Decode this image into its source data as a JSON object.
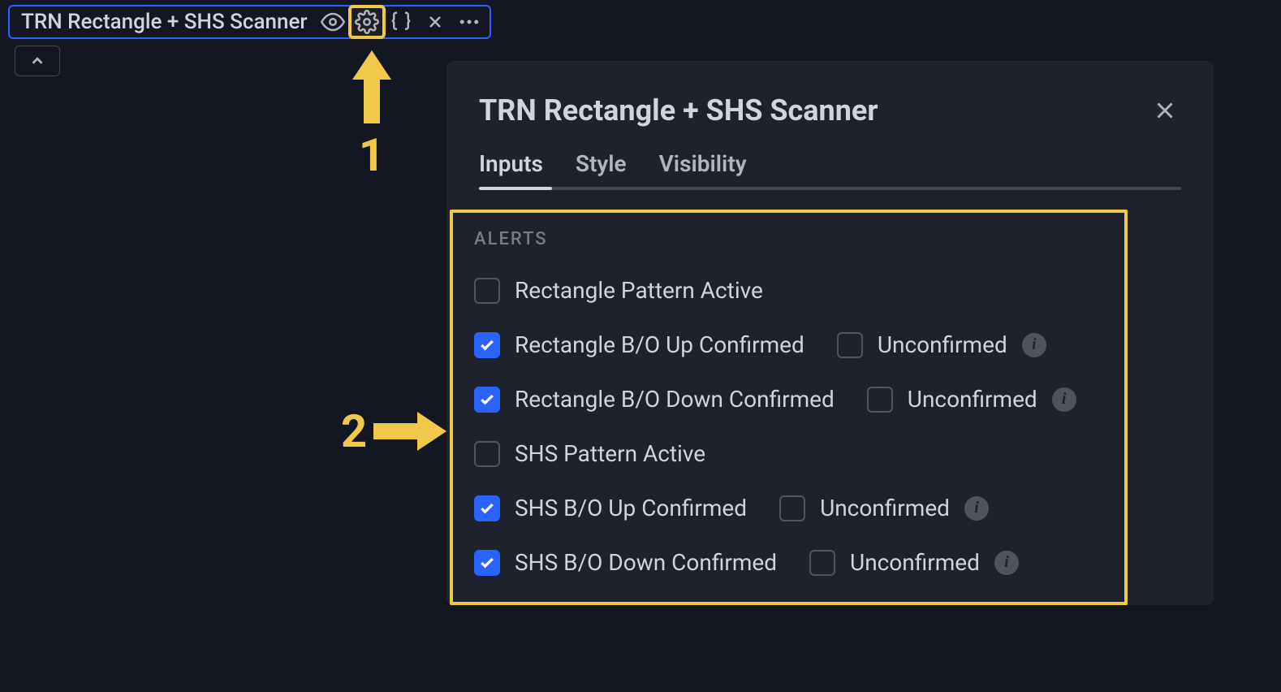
{
  "toolbar": {
    "title": "TRN Rectangle + SHS Scanner"
  },
  "annotations": {
    "one": "1",
    "two": "2"
  },
  "dialog": {
    "title": "TRN Rectangle + SHS Scanner",
    "tabs": {
      "inputs": "Inputs",
      "style": "Style",
      "visibility": "Visibility"
    },
    "section_label": "ALERTS",
    "options": {
      "rect_active": "Rectangle Pattern Active",
      "rect_bo_up": "Rectangle B/O Up Confirmed",
      "rect_bo_down": "Rectangle B/O Down Confirmed",
      "shs_active": "SHS Pattern Active",
      "shs_bo_up": "SHS B/O Up Confirmed",
      "shs_bo_down": "SHS B/O Down Confirmed",
      "unconfirmed": "Unconfirmed"
    }
  }
}
